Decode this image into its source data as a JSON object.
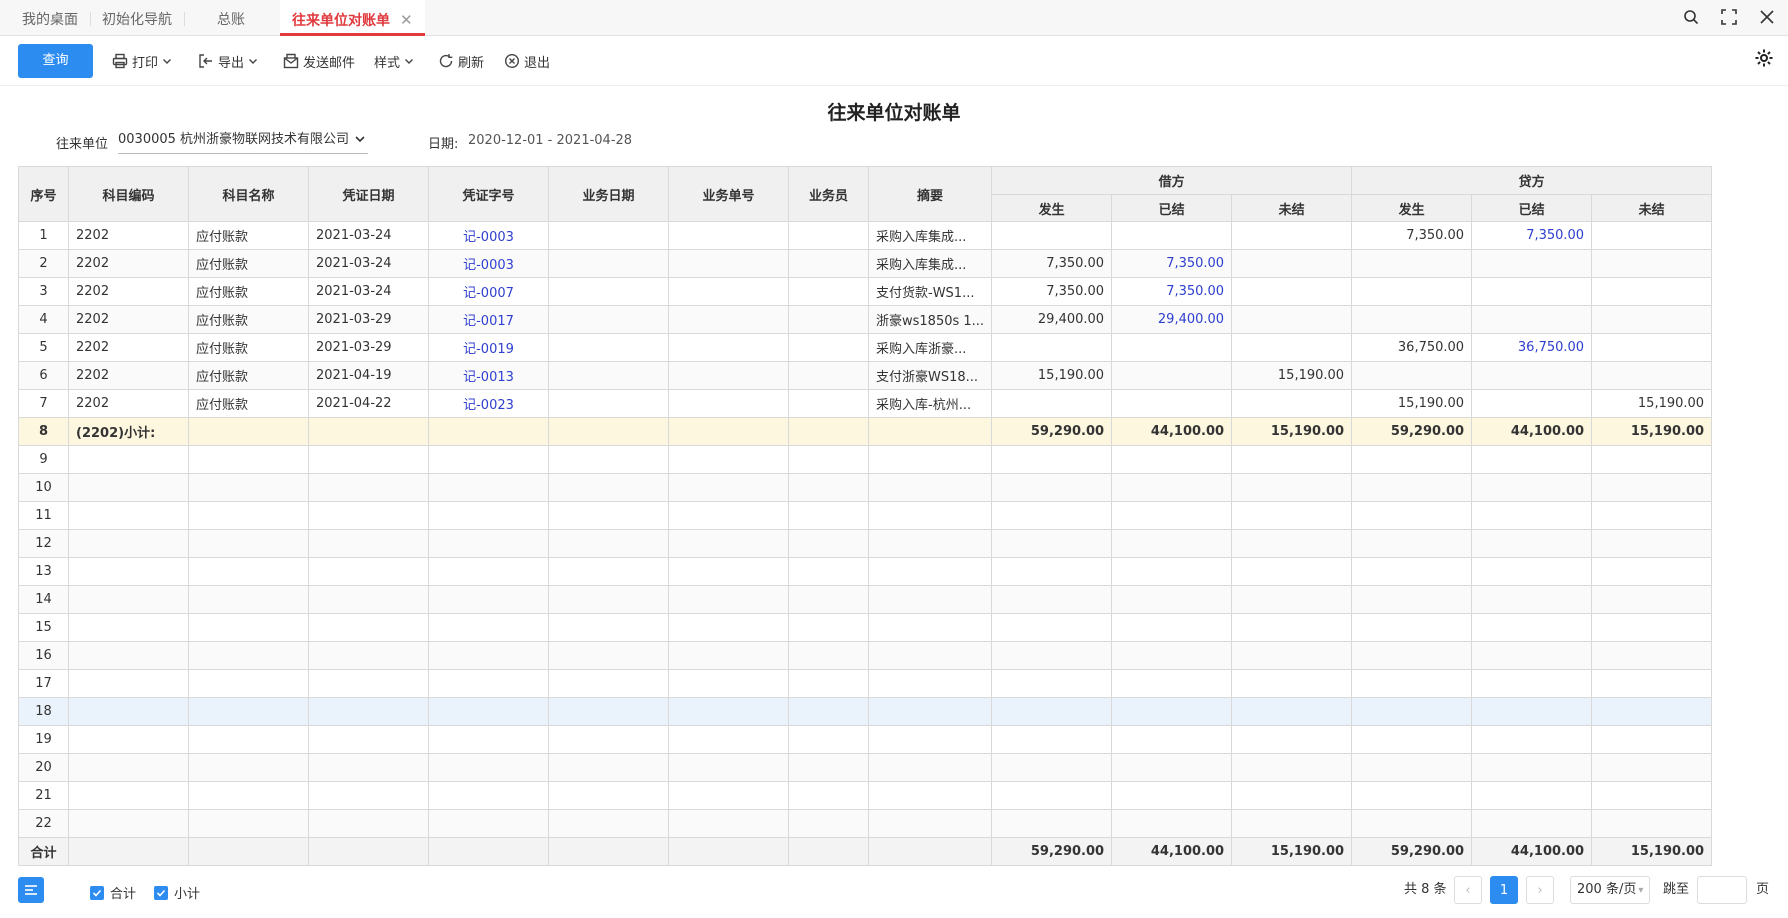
{
  "tabs": [
    {
      "label": "我的桌面"
    },
    {
      "label": "初始化导航"
    },
    {
      "label": "总账"
    },
    {
      "label": "往来单位对账单",
      "active": true
    }
  ],
  "toolbar": {
    "query": "查询",
    "print": "打印",
    "export": "导出",
    "send_mail": "发送邮件",
    "style": "样式",
    "refresh": "刷新",
    "exit": "退出"
  },
  "title": "往来单位对账单",
  "filter": {
    "unit_label": "往来单位",
    "unit_value": "0030005 杭州浙豪物联网技术有限公司",
    "date_label": "日期:",
    "date_value": "2020-12-01 - 2021-04-28"
  },
  "table": {
    "headers": [
      "序号",
      "科目编码",
      "科目名称",
      "凭证日期",
      "凭证字号",
      "业务日期",
      "业务单号",
      "业务员",
      "摘要"
    ],
    "group_debit": "借方",
    "group_credit": "贷方",
    "sub_headers": [
      "发生",
      "已结",
      "未结",
      "发生",
      "已结",
      "未结"
    ],
    "rows": [
      {
        "no": "1",
        "code": "2202",
        "name": "应付账款",
        "vdate": "2021-03-24",
        "vno": "记-0003",
        "bdate": "",
        "bno": "",
        "staff": "",
        "memo": "采购入库集成...",
        "d_occ": "",
        "d_set": "",
        "d_uns": "",
        "c_occ": "7,350.00",
        "c_set": "7,350.00",
        "c_uns": ""
      },
      {
        "no": "2",
        "code": "2202",
        "name": "应付账款",
        "vdate": "2021-03-24",
        "vno": "记-0003",
        "bdate": "",
        "bno": "",
        "staff": "",
        "memo": "采购入库集成...",
        "d_occ": "7,350.00",
        "d_set": "7,350.00",
        "d_uns": "",
        "c_occ": "",
        "c_set": "",
        "c_uns": ""
      },
      {
        "no": "3",
        "code": "2202",
        "name": "应付账款",
        "vdate": "2021-03-24",
        "vno": "记-0007",
        "bdate": "",
        "bno": "",
        "staff": "",
        "memo": "支付货款-WS1...",
        "d_occ": "7,350.00",
        "d_set": "7,350.00",
        "d_uns": "",
        "c_occ": "",
        "c_set": "",
        "c_uns": ""
      },
      {
        "no": "4",
        "code": "2202",
        "name": "应付账款",
        "vdate": "2021-03-29",
        "vno": "记-0017",
        "bdate": "",
        "bno": "",
        "staff": "",
        "memo": "浙豪ws1850s 1...",
        "d_occ": "29,400.00",
        "d_set": "29,400.00",
        "d_uns": "",
        "c_occ": "",
        "c_set": "",
        "c_uns": ""
      },
      {
        "no": "5",
        "code": "2202",
        "name": "应付账款",
        "vdate": "2021-03-29",
        "vno": "记-0019",
        "bdate": "",
        "bno": "",
        "staff": "",
        "memo": "采购入库浙豪...",
        "d_occ": "",
        "d_set": "",
        "d_uns": "",
        "c_occ": "36,750.00",
        "c_set": "36,750.00",
        "c_uns": ""
      },
      {
        "no": "6",
        "code": "2202",
        "name": "应付账款",
        "vdate": "2021-04-19",
        "vno": "记-0013",
        "bdate": "",
        "bno": "",
        "staff": "",
        "memo": "支付浙豪WS18...",
        "d_occ": "15,190.00",
        "d_set": "",
        "d_uns": "15,190.00",
        "c_occ": "",
        "c_set": "",
        "c_uns": ""
      },
      {
        "no": "7",
        "code": "2202",
        "name": "应付账款",
        "vdate": "2021-04-22",
        "vno": "记-0023",
        "bdate": "",
        "bno": "",
        "staff": "",
        "memo": "采购入库-杭州...",
        "d_occ": "",
        "d_set": "",
        "d_uns": "",
        "c_occ": "15,190.00",
        "c_set": "",
        "c_uns": "15,190.00"
      }
    ],
    "subtotal": {
      "no": "8",
      "label": "(2202)小计:",
      "d_occ": "59,290.00",
      "d_set": "44,100.00",
      "d_uns": "15,190.00",
      "c_occ": "59,290.00",
      "c_set": "44,100.00",
      "c_uns": "15,190.00"
    },
    "empty_rows": [
      "9",
      "10",
      "11",
      "12",
      "13",
      "14",
      "15",
      "16",
      "17",
      "18",
      "19",
      "20",
      "21",
      "22"
    ],
    "total": {
      "label": "合计",
      "d_occ": "59,290.00",
      "d_set": "44,100.00",
      "d_uns": "15,190.00",
      "c_occ": "59,290.00",
      "c_set": "44,100.00",
      "c_uns": "15,190.00"
    }
  },
  "footer": {
    "check_total": "合计",
    "check_subtotal": "小计",
    "count_text": "共 8 条",
    "page": "1",
    "page_size": "200 条/页",
    "jump_label": "跳至",
    "page_unit": "页"
  },
  "colors": {
    "accent": "#2d8cf0",
    "active_tab": "#e0393e",
    "link": "#2e3fcf",
    "subtotal_bg": "#fdf7df"
  }
}
